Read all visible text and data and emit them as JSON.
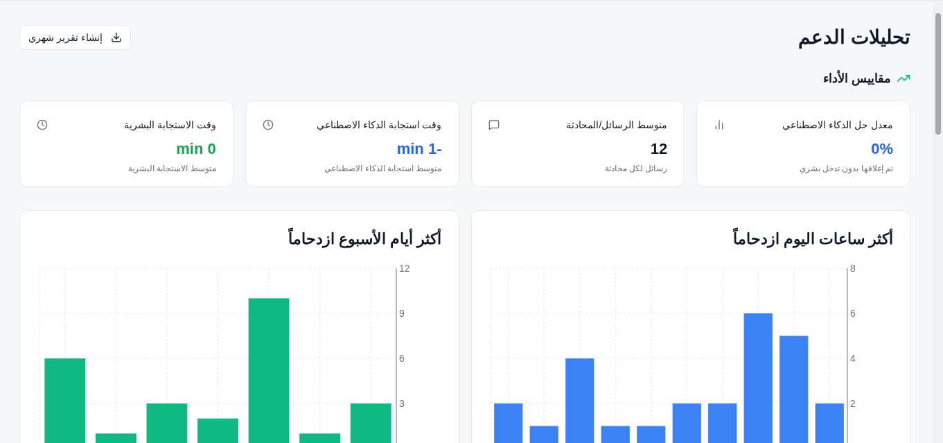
{
  "header": {
    "title": "تحليلات الدعم",
    "report_button": "إنشاء تقرير شهري"
  },
  "section_title": "مقاييس الأداء",
  "metrics": [
    {
      "kind": "rate",
      "title": "معدل حل الذكاء الاصطناعي",
      "value": "0%",
      "caption": "تم إغلاقها بدون تدخل بشري",
      "color": "#2563eb"
    },
    {
      "kind": "messages",
      "title": "متوسط الرسائل/المحادثة",
      "value": "12",
      "caption": "رسائل لكل محادثة",
      "color": "#111827"
    },
    {
      "kind": "clock",
      "title": "وقت استجابة الذكاء الاصطناعي",
      "value": "-1 min",
      "caption": "متوسط استجابة الذكاء الاصطناعي",
      "color": "#2563eb"
    },
    {
      "kind": "clock",
      "title": "وقت الاستجابة البشرية",
      "value": "0 min",
      "caption": "متوسط الاستجابة البشرية",
      "color": "#16a34a"
    }
  ],
  "charts": [
    {
      "title": "أكثر ساعات اليوم ازدحاماً",
      "chart_data": {
        "type": "bar",
        "grid": true,
        "ylim": [
          0,
          8
        ],
        "yticks": [
          2,
          4,
          6,
          8
        ],
        "series": [
          {
            "color": "#3b82f6",
            "values": [
              2,
              1,
              4,
              1,
              1,
              2,
              2,
              6,
              5,
              2
            ]
          }
        ]
      }
    },
    {
      "title": "أكثر أيام الأسبوع ازدحاماً",
      "chart_data": {
        "type": "bar",
        "grid": true,
        "ylim": [
          0,
          12
        ],
        "yticks": [
          3,
          6,
          9,
          12
        ],
        "series": [
          {
            "color": "#10b981",
            "values": [
              6,
              1,
              3,
              2,
              10,
              1,
              3
            ]
          }
        ]
      }
    }
  ]
}
